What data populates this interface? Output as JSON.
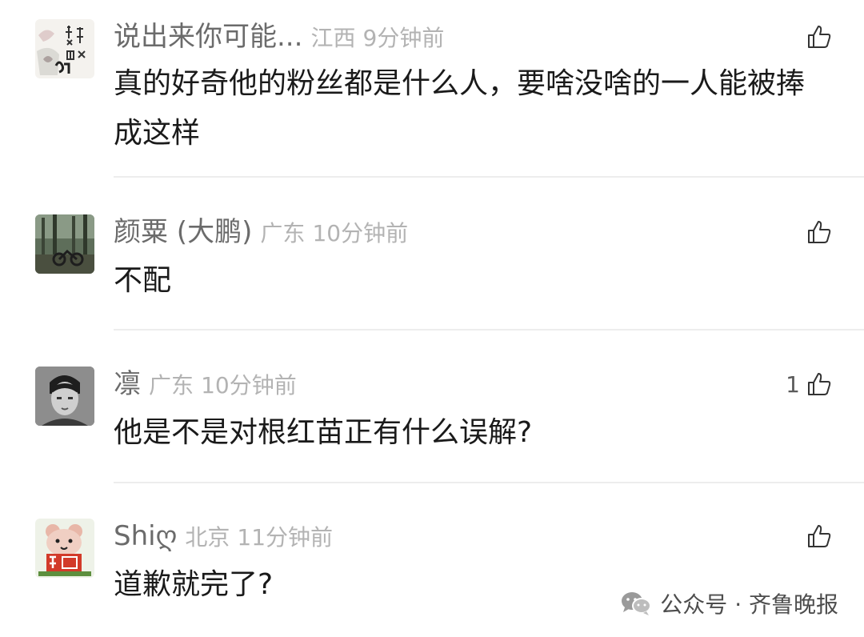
{
  "comments": [
    {
      "nickname": "说出来你可能...",
      "location": "江西",
      "time": "9分钟前",
      "content_lines": [
        "真的好奇他的粉丝都是什么人，要啥没啥的一人能被捧",
        "成这样"
      ],
      "likes": ""
    },
    {
      "nickname": "颜粟 (大鹏)",
      "location": "广东",
      "time": "10分钟前",
      "content_lines": [
        "不配"
      ],
      "likes": ""
    },
    {
      "nickname": "凛",
      "location": "广东",
      "time": "10分钟前",
      "content_lines": [
        "他是不是对根红苗正有什么误解?"
      ],
      "likes": "1"
    },
    {
      "nickname": "Shiღ",
      "location": "北京",
      "time": "11分钟前",
      "content_lines": [
        "道歉就完了?"
      ],
      "likes": ""
    }
  ],
  "watermark": {
    "text": "公众号 · 齐鲁晚报",
    "icon": "wechat-icon"
  },
  "icons": {
    "like": "thumbs-up-icon"
  },
  "colors": {
    "nickname": "#6b6b6b",
    "meta": "#b3b3b3",
    "content": "#1a1a1a",
    "divider": "#ededed"
  }
}
